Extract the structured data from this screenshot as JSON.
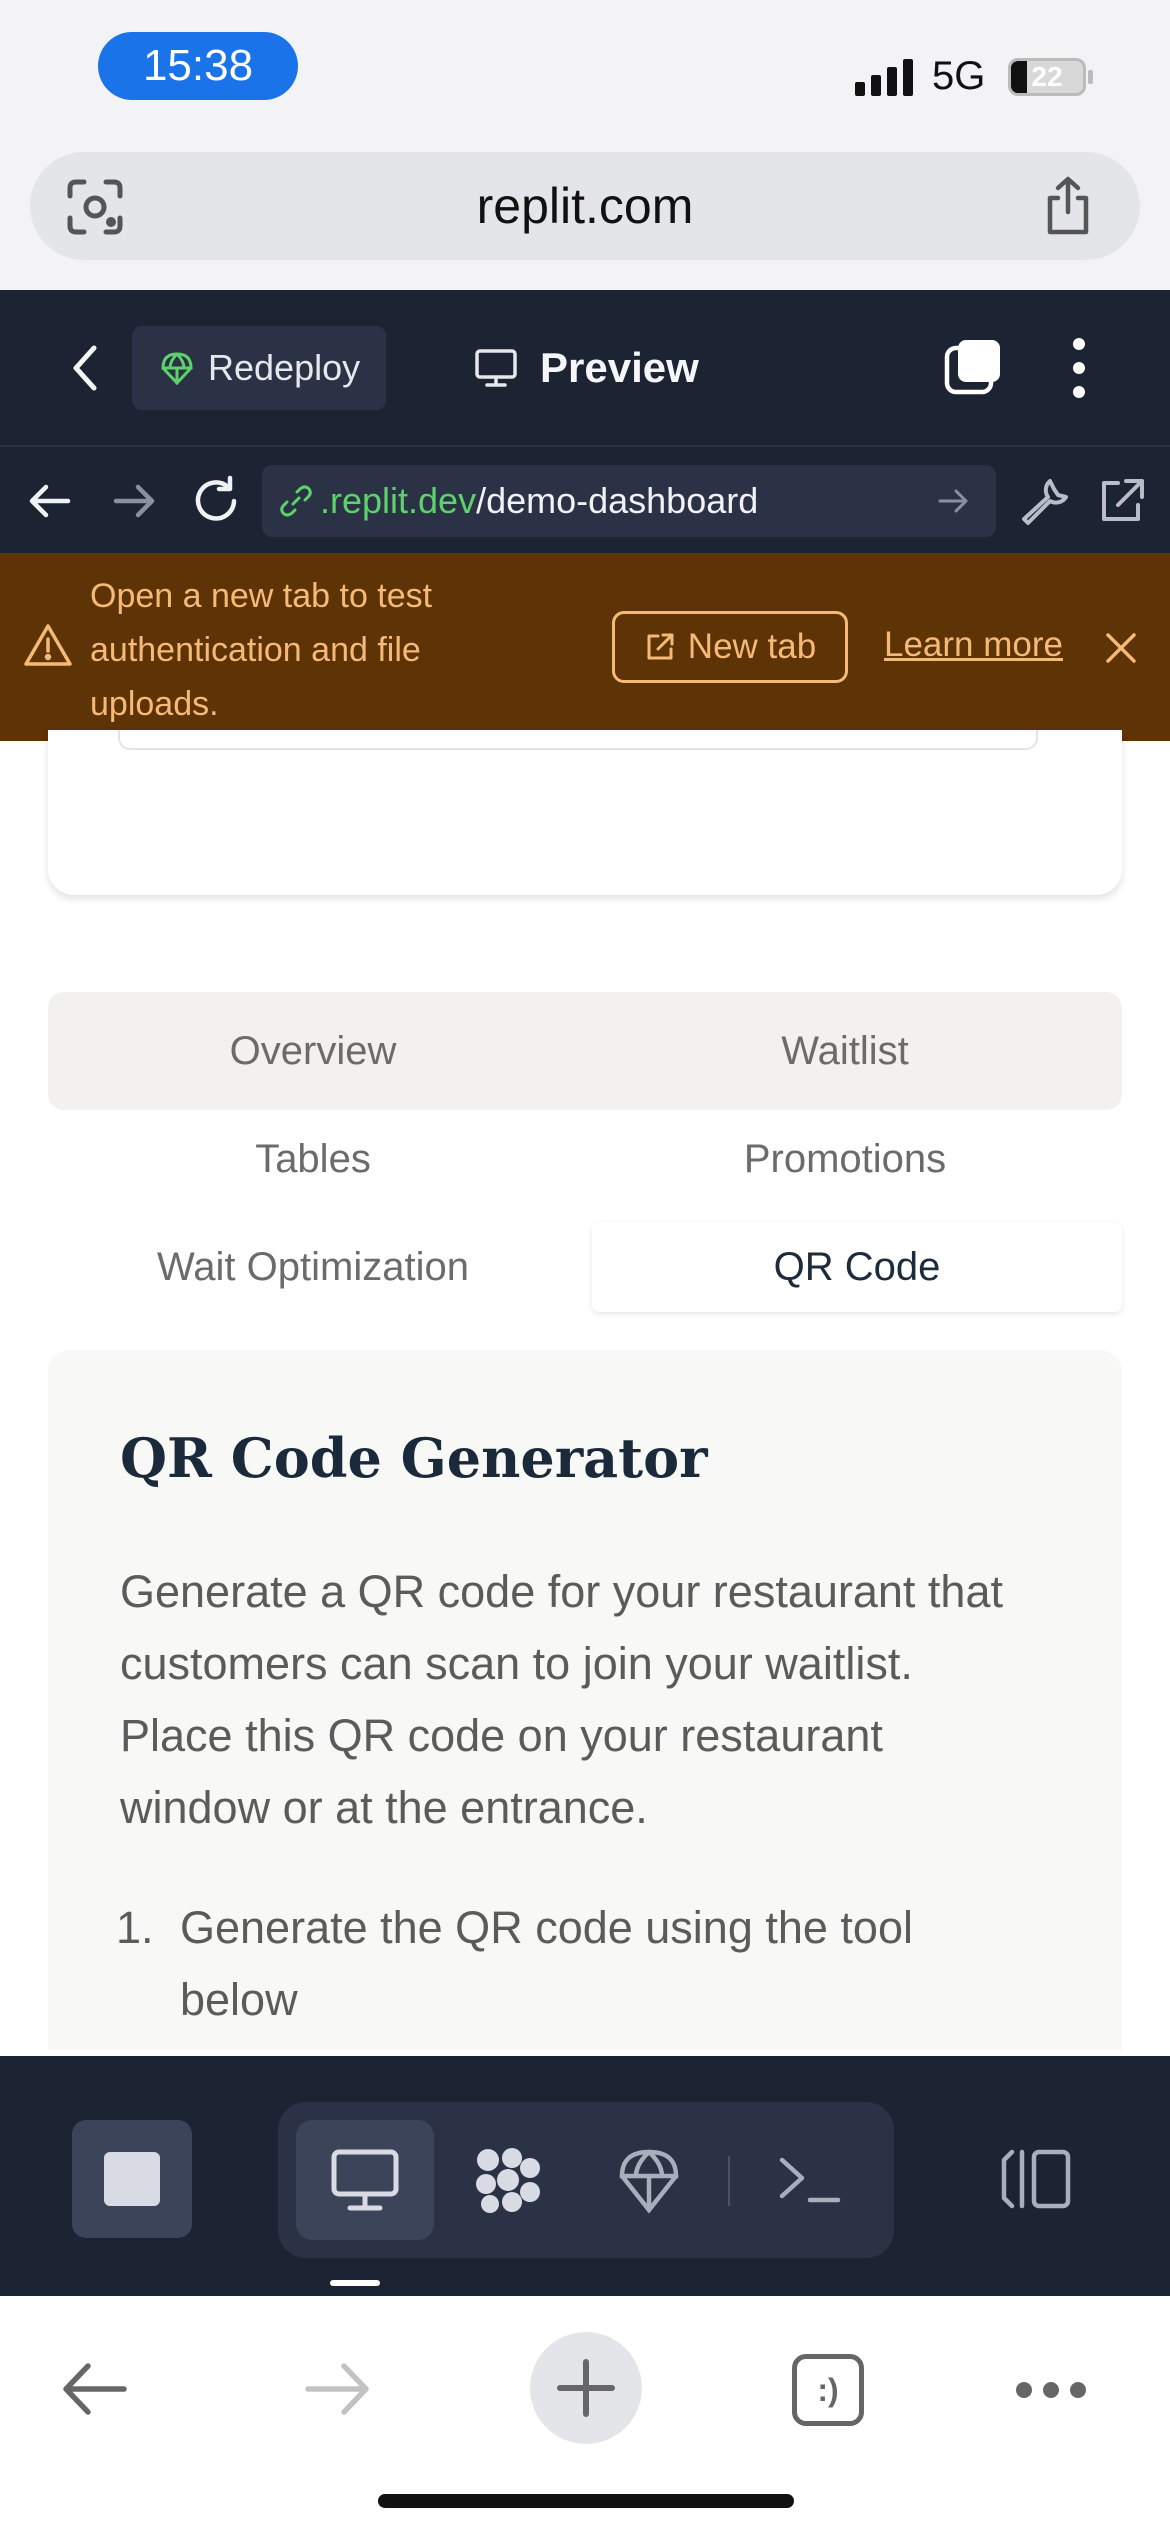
{
  "status_bar": {
    "time": "15:38",
    "network": "5G",
    "battery_level": "22",
    "battery_fraction": 0.22
  },
  "safari": {
    "domain": "replit.com",
    "camera_icon": "scan-camera-icon",
    "share_icon": "share-icon"
  },
  "replit_toolbar": {
    "back_icon": "chevron-left-icon",
    "redeploy_label": "Redeploy",
    "preview_label": "Preview",
    "tabs_icon": "tabs-icon",
    "menu_icon": "more-vertical-icon"
  },
  "browser_nav": {
    "url_host": ".replit.dev",
    "url_path": "/demo-dashboard",
    "icons": [
      "arrow-left-icon",
      "arrow-right-icon",
      "reload-icon",
      "link-icon",
      "go-arrow-icon",
      "wrench-icon",
      "external-link-icon"
    ]
  },
  "banner": {
    "message": "Open a new tab to test authentication and file uploads.",
    "new_tab_label": "New tab",
    "learn_more_label": "Learn more",
    "colors": {
      "background": "#5e3306",
      "text": "#f5b978"
    }
  },
  "tabs": [
    {
      "label": "Overview",
      "active": false
    },
    {
      "label": "Waitlist",
      "active": false
    },
    {
      "label": "Tables",
      "active": false
    },
    {
      "label": "Promotions",
      "active": false
    },
    {
      "label": "Wait Optimization",
      "active": false
    },
    {
      "label": "QR Code",
      "active": true
    }
  ],
  "qr_section": {
    "title": "QR Code Generator",
    "description": "Generate a QR code for your restaurant that customers can scan to join your waitlist. Place this QR code on your restaurant window or at the entrance.",
    "steps": [
      {
        "number": "1.",
        "text": "Generate the QR code using the tool below"
      }
    ]
  },
  "dock": {
    "icons": [
      "stop-icon",
      "desktop-preview-icon",
      "apps-icon",
      "deploy-icon",
      "console-icon",
      "panel-toggle-icon"
    ],
    "active": "desktop-preview-icon"
  },
  "safari_bottom": {
    "icons": [
      "back-arrow-icon",
      "forward-arrow-icon",
      "new-tab-plus-icon",
      "tabs-count-icon",
      "more-icon"
    ],
    "tabs_label": ":)"
  },
  "colors": {
    "replit_dark": "#1c2333",
    "replit_panel": "#2b3245",
    "accent_green": "#5dd26a",
    "time_pill": "#1a73e8"
  }
}
